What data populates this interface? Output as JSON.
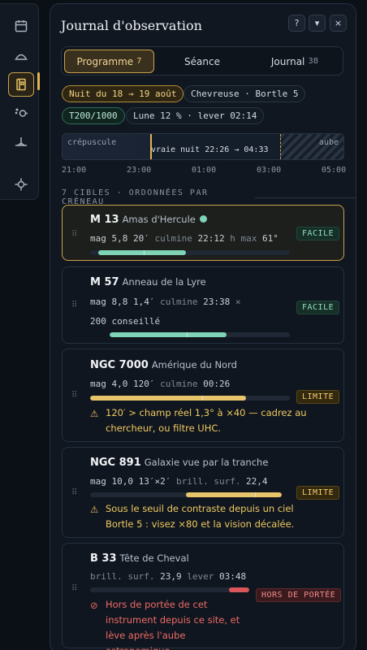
{
  "rail": {
    "items": [
      {
        "icon": "calendar-icon"
      },
      {
        "icon": "horizon-arc-icon"
      },
      {
        "icon": "journal-icon",
        "active": true
      },
      {
        "icon": "planets-icon"
      },
      {
        "icon": "telescope-mount-icon"
      },
      {
        "icon": "crosshair-icon"
      }
    ]
  },
  "header": {
    "title": "Journal d'observation",
    "help": "?",
    "collapse": "▾",
    "close": "×"
  },
  "tabs": [
    {
      "label": "Programme",
      "count": "7",
      "active": true
    },
    {
      "label": "Séance",
      "count": ""
    },
    {
      "label": "Journal",
      "count": "38"
    }
  ],
  "chips": {
    "night": "Nuit du 18 → 19 août",
    "site": "Chevreuse · Bortle 5",
    "scope": "T200/1000",
    "moon": "Lune 12 % · lever 02:14"
  },
  "timeline": {
    "dusk_label": "crépuscule",
    "night_label": "vraie nuit 22:26 → 04:33",
    "dawn_label": "aube",
    "ticks": [
      "21:00",
      "23:00",
      "01:00",
      "03:00",
      "05:00"
    ]
  },
  "section_title": "7 CIBLES · ORDONNÉES PAR CRÉNEAU",
  "targets": [
    {
      "name": "M 13",
      "desc": "Amas d'Hercule",
      "meta": [
        [
          "mag 5,8",
          ""
        ],
        [
          "20′",
          ""
        ],
        [
          "culmine",
          "dim"
        ],
        [
          "22:12",
          ""
        ],
        [
          "h max",
          "dim"
        ],
        [
          "61°",
          ""
        ]
      ],
      "status": "FACILE",
      "window_start": 0.04,
      "window_end": 0.48,
      "marker": 0.27,
      "fill": "#7fd3b6"
    },
    {
      "name": "M 57",
      "desc": "Anneau de la Lyre",
      "meta": [
        [
          "mag 8,8",
          ""
        ],
        [
          "1,4′",
          ""
        ],
        [
          "culmine",
          "dim"
        ],
        [
          "23:38",
          ""
        ],
        [
          "×",
          "dim"
        ]
      ],
      "meta2": "200 conseillé",
      "status": "FACILE",
      "window_start": 0.0,
      "window_end": 0.65,
      "marker": 0.43,
      "fill": "#7fd3b6"
    },
    {
      "name": "NGC 7000",
      "desc": "Amérique du Nord",
      "meta": [
        [
          "mag 4,0",
          ""
        ],
        [
          "120′",
          ""
        ],
        [
          "culmine",
          "dim"
        ],
        [
          "00:26",
          ""
        ]
      ],
      "status": "LIMITE",
      "window_start": 0.0,
      "window_end": 0.78,
      "marker": 0.56,
      "fill": "#e8c46a",
      "warning": "120′ > champ réel 1,3° à ×40 — cadrez au chercheur, ou filtre UHC."
    },
    {
      "name": "NGC 891",
      "desc": "Galaxie vue par la tranche",
      "meta": [
        [
          "mag 10,0",
          ""
        ],
        [
          "13′×2′",
          ""
        ],
        [
          "brill. surf.",
          "dim"
        ],
        [
          "22,4",
          ""
        ]
      ],
      "status": "LIMITE",
      "window_start": 0.5,
      "window_end": 1.0,
      "marker": 0.86,
      "fill": "#e8c46a",
      "warning": "Sous le seuil de contraste depuis un ciel Bortle 5 : visez ×80 et la vision décalée."
    },
    {
      "name": "B 33",
      "desc": "Tête de Cheval",
      "meta": [
        [
          "brill. surf.",
          "dim"
        ],
        [
          "23,9",
          ""
        ],
        [
          "lever",
          "dim"
        ],
        [
          "03:48",
          ""
        ]
      ],
      "status": "HORS DE PORTÉE",
      "window_start": 0.87,
      "window_end": 1.0,
      "fill": "#d9575a",
      "warning": "Hors de portée de cet instrument depuis ce site, et lève après l'aube astronomique."
    }
  ],
  "colors": {
    "accent": "#e2b552",
    "easy": "#7fd3b6",
    "limit": "#e8c46a",
    "out": "#d9575a"
  }
}
